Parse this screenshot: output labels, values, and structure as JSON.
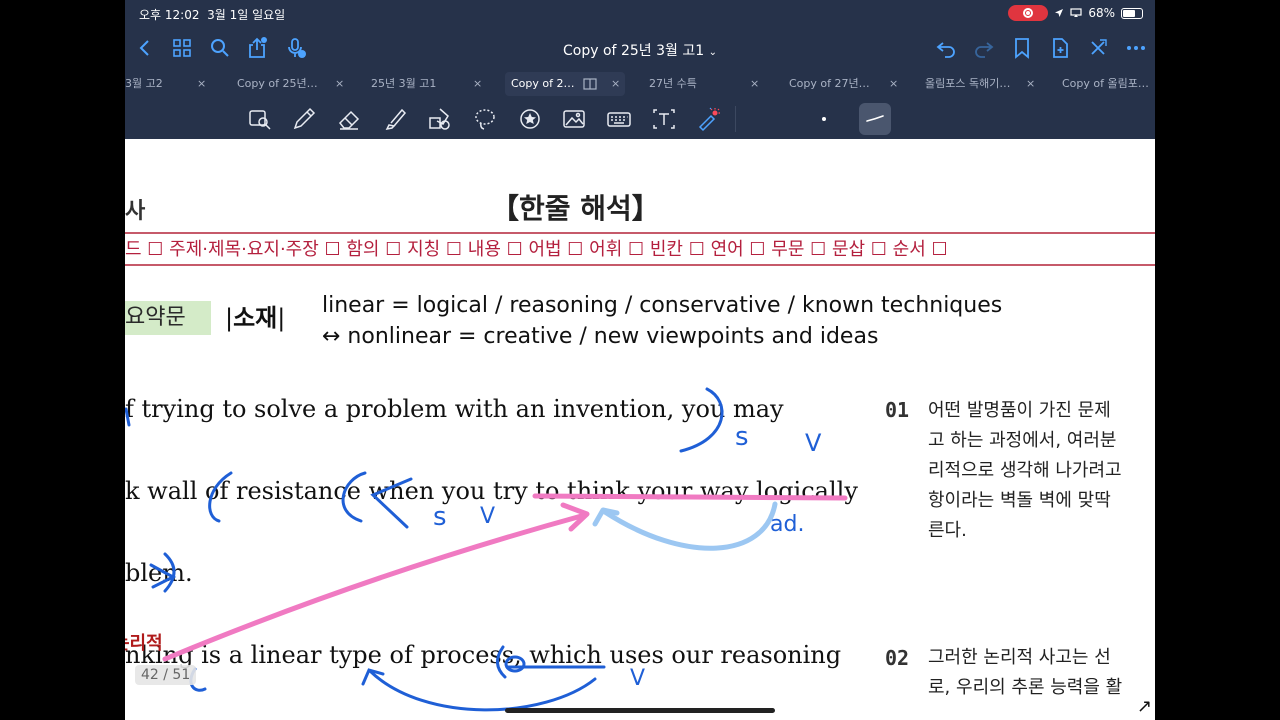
{
  "status": {
    "time": "오후 12:02",
    "date": "3월 1일 일요일",
    "battery": "68%",
    "battery_level": 0.68
  },
  "nav": {
    "title": "Copy of 25년 3월 고1",
    "title_chevron": "⌄",
    "left_icons": [
      "back-chevron-icon",
      "grid-icon",
      "search-icon",
      "share-icon",
      "microphone-icon"
    ],
    "right_icons": [
      "undo-icon",
      "redo-icon",
      "bookmark-icon",
      "add-page-icon",
      "close-x-icon",
      "more-icon"
    ]
  },
  "tabs": [
    {
      "label": "3월 고2"
    },
    {
      "label": "Copy of 25년…"
    },
    {
      "label": "25년 3월 고1"
    },
    {
      "label": "Copy of 2…",
      "active": true
    },
    {
      "label": "27년 수특"
    },
    {
      "label": "Copy of 27년…"
    },
    {
      "label": "올림포스 독해기…"
    },
    {
      "label": "Copy of 올림포…"
    }
  ],
  "tab_close": "×",
  "tools": [
    "lasso-zoom-icon",
    "pen-icon",
    "eraser-icon",
    "highlighter-icon",
    "shapes-icon",
    "lasso-icon",
    "sticker-icon",
    "image-icon",
    "keyboard-icon",
    "text-box-icon",
    "laser-pointer-icon"
  ],
  "doc": {
    "left_label": "사",
    "section_title": "【한줄 해석】",
    "categories": "드 ☐ 주제·제목·요지·주장 ☐ 함의 ☐ 지칭 ☐ 내용 ☐ 어법 ☐ 어휘 ☐ 빈칸 ☐ 연어 ☐ 무문 ☐ 문삽 ☐ 순서 ☐",
    "summary_tag": "요약문",
    "topic_open": "|",
    "topic_label": "소재",
    "topic_close": "|",
    "topic_line1": "linear = logical / reasoning / conservative / known techniques",
    "topic_line2": "↔ nonlinear = creative / new viewpoints and ideas",
    "eng_lines": [
      "f  trying  to  solve  a  problem  with  an  invention,  you  may",
      "k wall of resistance when you try to think your way logically",
      "blem.",
      "nking is a linear type of process, which uses our reasoning"
    ],
    "items": [
      {
        "num": "01",
        "lines": [
          "어떤 발명품이 가진 문제",
          "고 하는 과정에서, 여러분",
          "리적으로 생각해 나가려고",
          "항이라는 벽돌 벽에 맞딱",
          "른다."
        ]
      },
      {
        "num": "02",
        "lines": [
          "그러한 논리적 사고는 선",
          "로, 우리의 추론 능력을 활"
        ]
      }
    ],
    "handwriting": {
      "s1": "s",
      "v1": "V",
      "s2": "s",
      "v2": "V",
      "ad": "ad.",
      "note": "논리적"
    },
    "page_indicator": "42 / 51",
    "corner_mark": "↗"
  },
  "colors": {
    "chrome": "#26324a",
    "accent": "#4da3ff",
    "category_red": "#b4203e",
    "summary_green": "#d4ebc8",
    "ink_blue": "#1f5fd6",
    "ink_pink": "#f07ac2",
    "ink_lightblue": "#9cc7f2"
  }
}
